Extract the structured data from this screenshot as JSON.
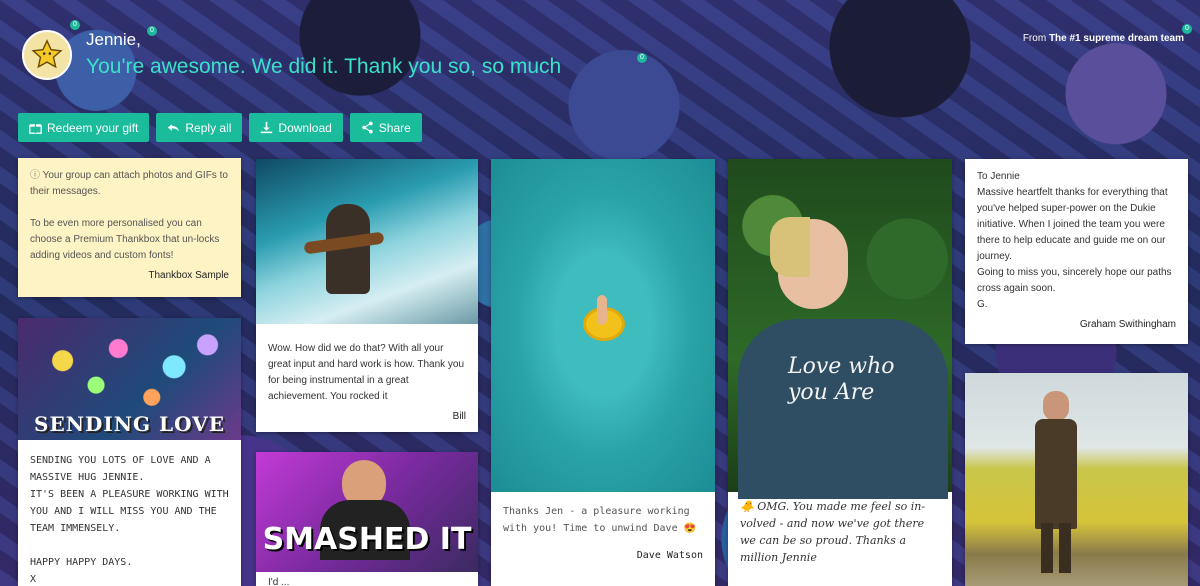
{
  "header": {
    "recipient": "Jennie,",
    "headline": "You're awesome. We did it. Thank you so, so much",
    "from_prefix": "From ",
    "from_team": "The #1 supreme dream team"
  },
  "actions": [
    {
      "label": "Redeem your gift",
      "icon": "gift-icon"
    },
    {
      "label": "Reply all",
      "icon": "reply-all-icon"
    },
    {
      "label": "Download",
      "icon": "download-icon"
    },
    {
      "label": "Share",
      "icon": "share-icon"
    }
  ],
  "cards": {
    "info": {
      "line1": "Your group can attach photos and GIFs to their messages.",
      "line2": "To be even more personalised you can choose a Premium Thankbox that un-locks adding videos and custom fonts!",
      "signature": "Thankbox Sample"
    },
    "sending_love": {
      "caption": "SENDING LOVE",
      "message": "SENDING YOU LOTS OF LOVE AND A MASSIVE HUG JENNIE.",
      "message2": "IT'S BEEN A PLEASURE WORKING WITH YOU AND I WILL MISS YOU AND THE TEAM IMMENSELY.",
      "message3": "HAPPY HAPPY DAYS.",
      "message4": "X"
    },
    "bill": {
      "message": "Wow. How did we do that?  With all your great input and hard work is how. Thank you for being instrumental in a great achievement. You rocked it",
      "signature": "Bill"
    },
    "smashed": {
      "caption": "SMASHED IT",
      "partial": "I'd ..."
    },
    "dave": {
      "message": "Thanks Jen - a pleasure working with you! Time to unwind Dave 😍",
      "signature": "Dave Watson"
    },
    "girl": {
      "shirt_text": "Love who you Are",
      "message": "🐥 OMG. You made me feel so in-volved - and now we've got there we can be so proud. Thanks a million Jennie"
    },
    "graham": {
      "to": "To Jennie",
      "message": "Massive heartfelt thanks for everything that you've helped super-power on the Dukie initiative.  When I joined the team you were there to help educate and guide me on our journey.",
      "message2": "Going to miss you, sincerely hope our paths cross again soon.",
      "message3": "G.",
      "signature": "Graham Swithingham"
    }
  },
  "colors": {
    "accent": "#1abc9c",
    "headline": "#3be0c9",
    "info_bg": "#fdf3c4"
  }
}
